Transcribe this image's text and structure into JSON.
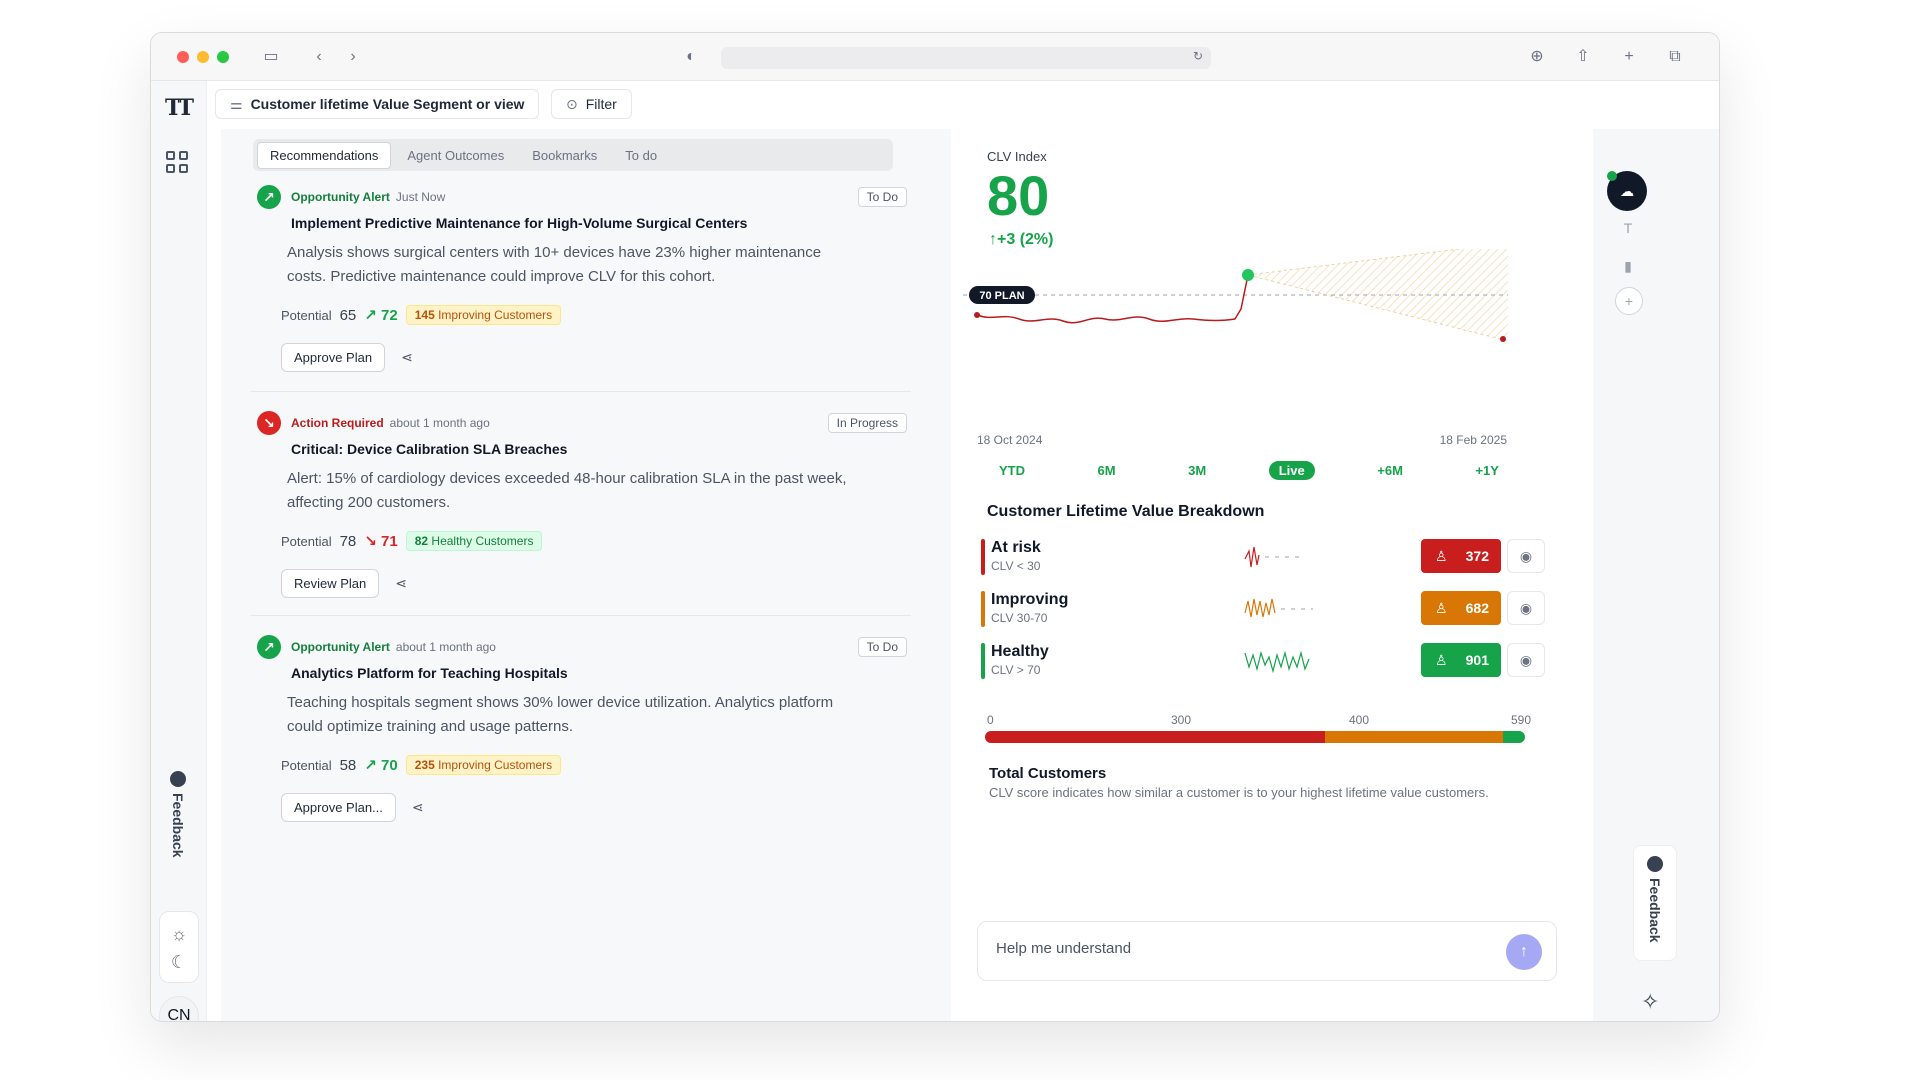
{
  "browser": {
    "colors": {
      "close": "#ff5f57",
      "minimize": "#febc2e",
      "maximize": "#28c840"
    }
  },
  "toolbar": {
    "segment_label": "Customer lifetime Value Segment or view",
    "filter_label": "Filter"
  },
  "left_rail": {
    "logo": "TT",
    "feedback_label": "Feedback",
    "avatar": "CN"
  },
  "feed": {
    "tabs": [
      "Recommendations",
      "Agent Outcomes",
      "Bookmarks",
      "To do"
    ],
    "cards": [
      {
        "type": "Opportunity Alert",
        "time": "Just Now",
        "status": "To Do",
        "title": "Implement Predictive Maintenance for High-Volume Surgical Centers",
        "body": "Analysis shows surgical centers with 10+ devices have 23% higher maintenance costs. Predictive maintenance could improve CLV for this cohort.",
        "potential_label": "Potential",
        "potential_from": "65",
        "potential_to": "72",
        "customers_count": "145",
        "customers_label": "Improving Customers",
        "action": "Approve Plan"
      },
      {
        "type": "Action Required",
        "time": "about 1 month ago",
        "status": "In Progress",
        "title": "Critical: Device Calibration SLA Breaches",
        "body": "Alert: 15% of cardiology devices exceeded 48-hour calibration SLA in the past week, affecting 200 customers.",
        "potential_label": "Potential",
        "potential_from": "78",
        "potential_to": "71",
        "customers_count": "82",
        "customers_label": "Healthy Customers",
        "action": "Review Plan"
      },
      {
        "type": "Opportunity Alert",
        "time": "about 1 month ago",
        "status": "To Do",
        "title": "Analytics Platform for Teaching Hospitals",
        "body": "Teaching hospitals segment shows 30% lower device utilization. Analytics platform could optimize training and usage patterns.",
        "potential_label": "Potential",
        "potential_from": "58",
        "potential_to": "70",
        "customers_count": "235",
        "customers_label": "Improving Customers",
        "action": "Approve Plan..."
      }
    ]
  },
  "panel": {
    "clv_label": "CLV Index",
    "clv_value": "80",
    "clv_delta": "+3 (2%)",
    "plan_label": "70 PLAN",
    "date_start": "18 Oct 2024",
    "date_end": "18 Feb 2025",
    "ranges": [
      "YTD",
      "6M",
      "3M",
      "Live",
      "+6M",
      "+1Y"
    ],
    "active_range": "Live",
    "breakdown_title": "Customer Lifetime Value Breakdown",
    "segments": [
      {
        "name": "At risk",
        "sub": "CLV < 30",
        "count": "372",
        "color": "#c81e1e"
      },
      {
        "name": "Improving",
        "sub": "CLV 30-70",
        "count": "682",
        "color": "#d97706"
      },
      {
        "name": "Healthy",
        "sub": "CLV > 70",
        "count": "901",
        "color": "#16a34a"
      }
    ],
    "scale": [
      "0",
      "300",
      "400",
      "590"
    ],
    "distribution": [
      {
        "name": "At risk",
        "share": 0.63,
        "color": "#c81e1e"
      },
      {
        "name": "Improving",
        "share": 0.33,
        "color": "#d97706"
      },
      {
        "name": "Healthy",
        "share": 0.04,
        "color": "#16a34a"
      }
    ],
    "total_title": "Total Customers",
    "total_desc": "CLV score indicates how similar a customer is to your highest lifetime value customers.",
    "chat_placeholder": "Help me understand"
  },
  "right_rail": {
    "feedback_label": "Feedback"
  },
  "chart_data": {
    "type": "line",
    "x": [
      "18 Oct 2024",
      "18 Feb 2025"
    ],
    "plan_value": 70,
    "current_value": 80,
    "series": [],
    "forecast_band": true
  }
}
